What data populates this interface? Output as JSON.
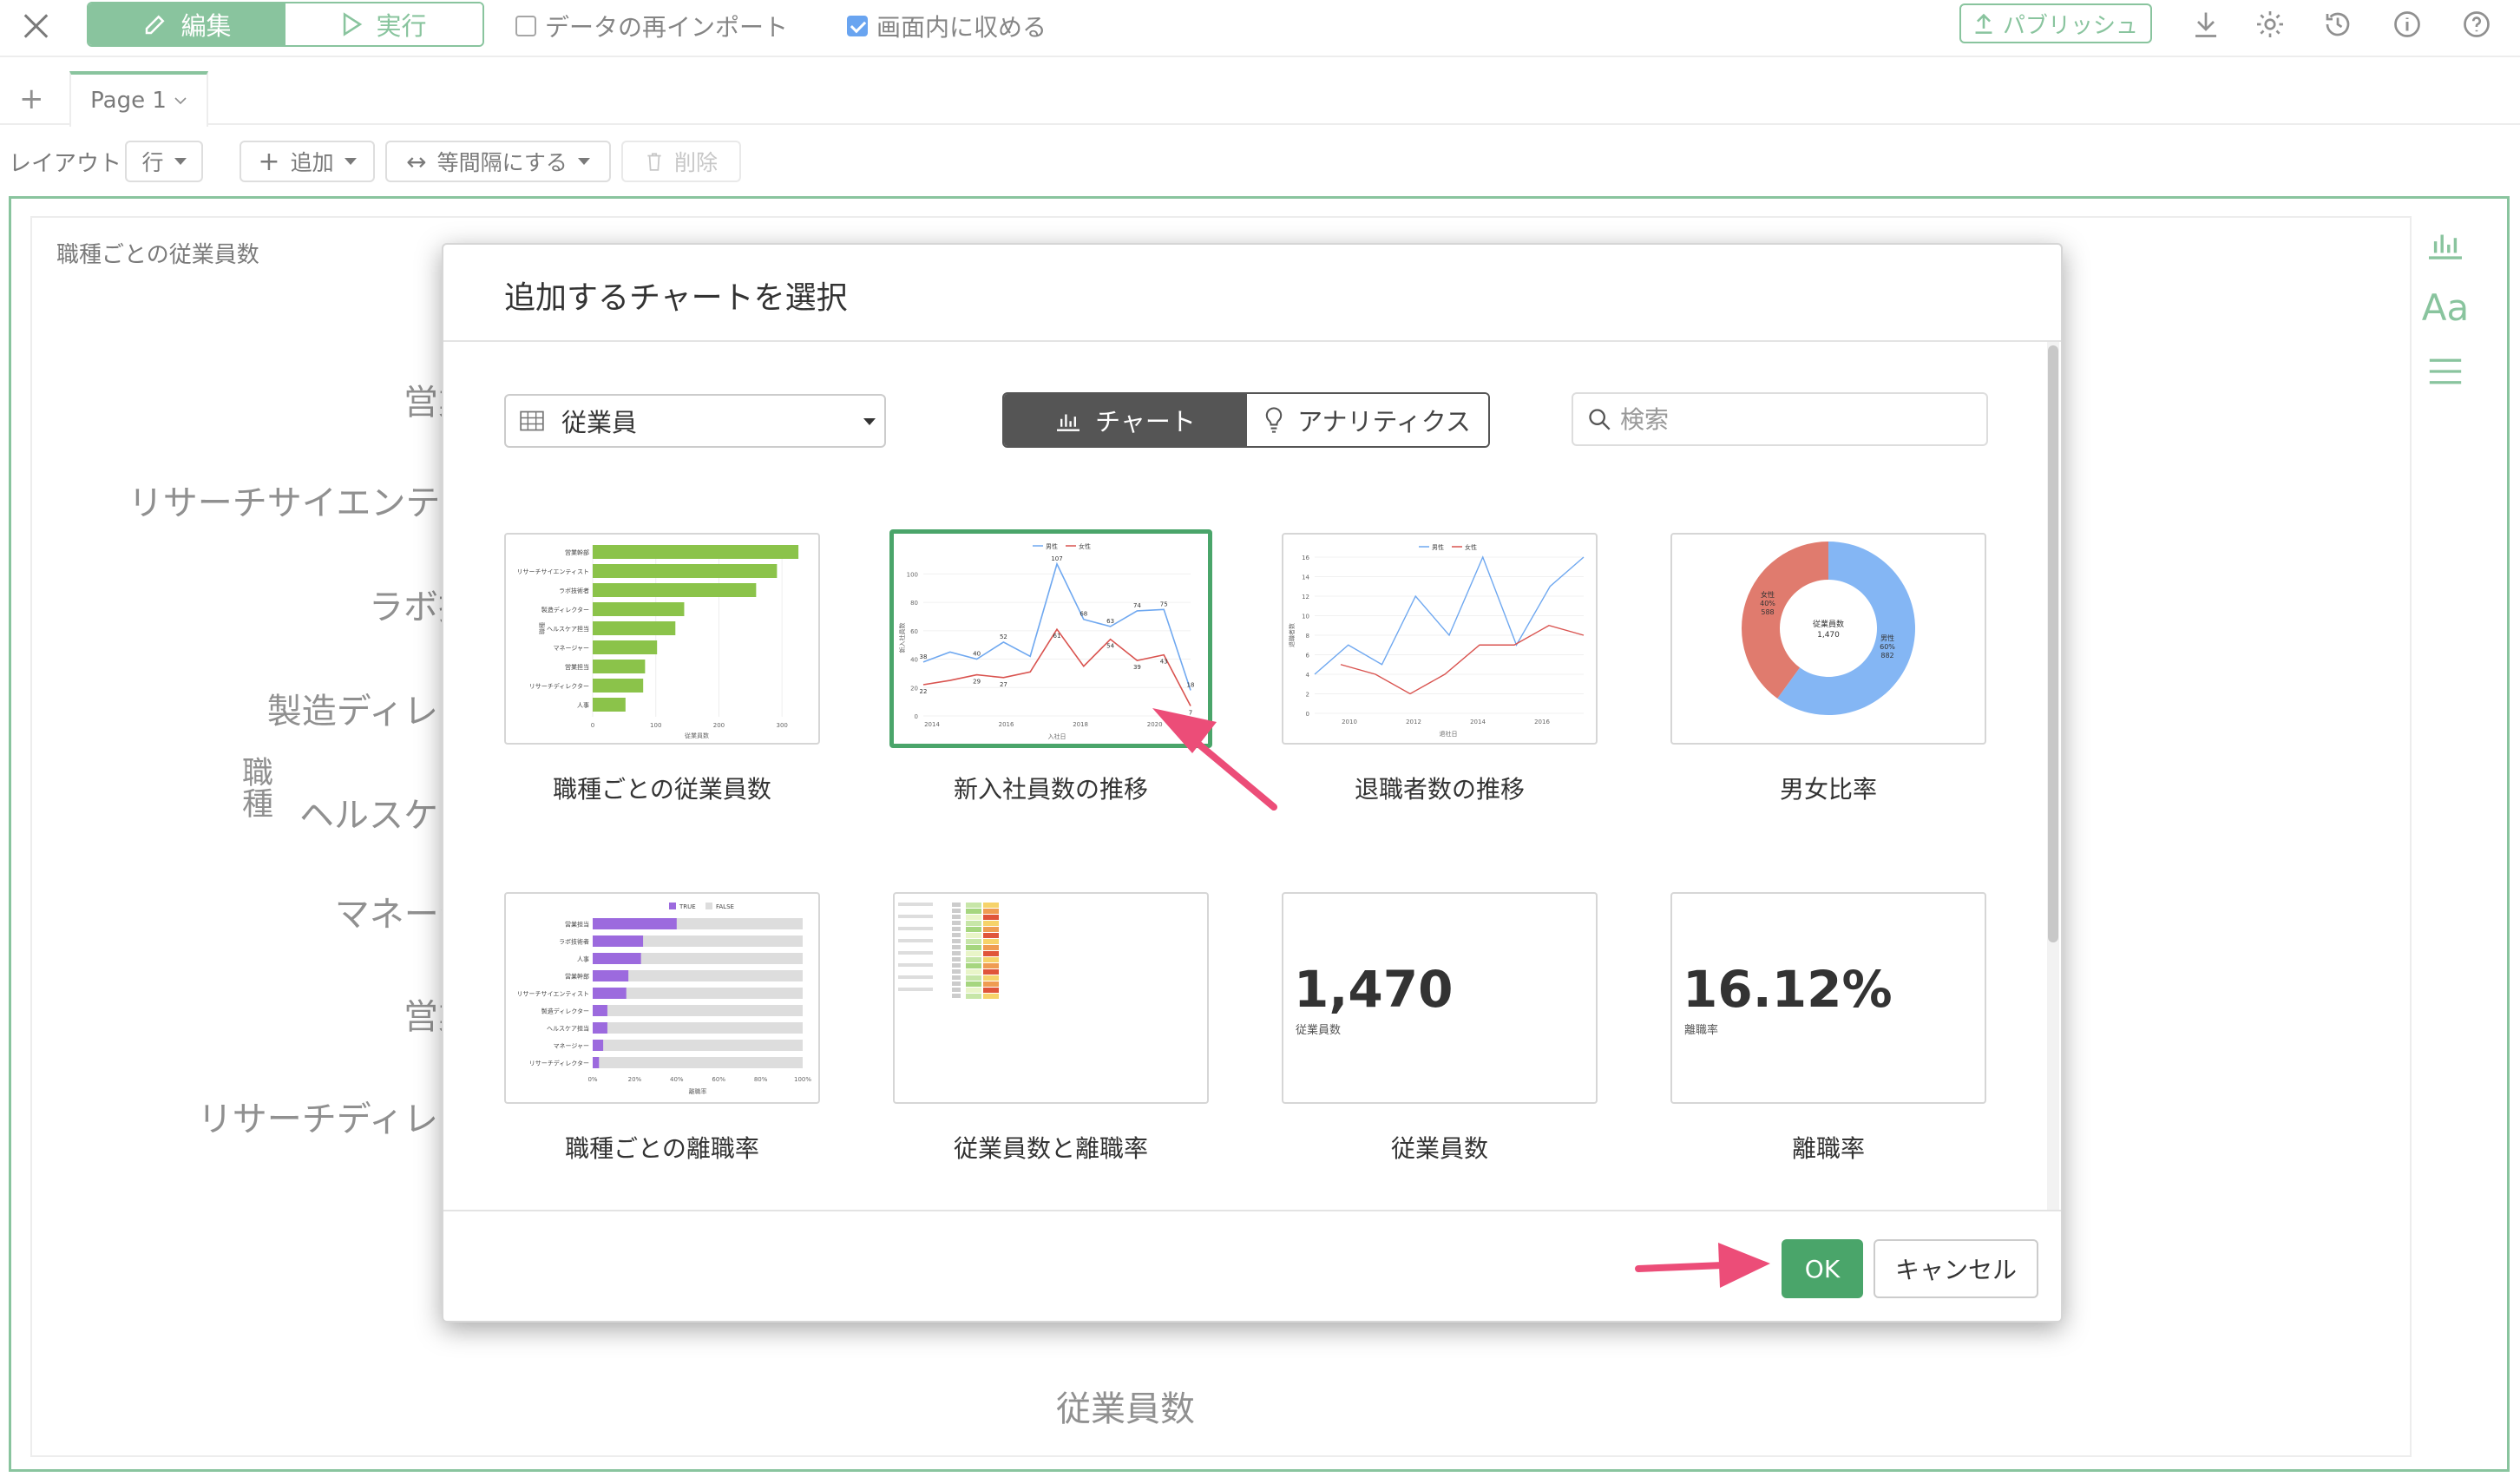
{
  "toolbar": {
    "edit_label": "編集",
    "run_label": "実行",
    "reimport_label": "データの再インポート",
    "reimport_checked": false,
    "fit_label": "画面内に収める",
    "fit_checked": true,
    "publish_label": "パブリッシュ",
    "icons": [
      "download-icon",
      "gear-icon",
      "history-icon",
      "info-icon",
      "help-icon"
    ],
    "accent_color": "#4aa56a"
  },
  "tabs": {
    "add_label": "+",
    "pages": [
      {
        "label": "Page 1"
      }
    ]
  },
  "layout_bar": {
    "layout_label": "レイアウト",
    "layout_value": "行",
    "add_label": "追加",
    "distribute_label": "等間隔にする",
    "delete_label": "削除"
  },
  "canvas": {
    "panel_title": "職種ごとの従業員数",
    "bg_labels": [
      "営業",
      "リサーチサイエンティ",
      "ラボ技",
      "製造ディレク",
      "ヘルスケア",
      "マネージ",
      "営業",
      "リサーチディレク"
    ],
    "bg_ylabel": "職種",
    "bg_xlabel": "従業員数",
    "side_icons": [
      "bar-chart-icon",
      "text-icon",
      "menu-icon"
    ]
  },
  "modal": {
    "title": "追加するチャートを選択",
    "dataset": "従業員",
    "segment_chart": "チャート",
    "segment_analytics": "アナリティクス",
    "search_placeholder": "検索",
    "ok_label": "OK",
    "cancel_label": "キャンセル",
    "cards": [
      {
        "label": "職種ごとの従業員数",
        "selected": false
      },
      {
        "label": "新入社員数の推移",
        "selected": true
      },
      {
        "label": "退職者数の推移",
        "selected": false
      },
      {
        "label": "男女比率",
        "selected": false
      },
      {
        "label": "職種ごとの離職率",
        "selected": false
      },
      {
        "label": "従業員数と離職率",
        "selected": false
      },
      {
        "label": "従業員数",
        "selected": false
      },
      {
        "label": "離職率",
        "selected": false
      }
    ]
  },
  "thumbnails": {
    "bar_headcount": {
      "categories": [
        "営業幹部",
        "リサーチサイエンティスト",
        "ラボ技術者",
        "製造ディレクター",
        "ヘルスケア担当",
        "マネージャー",
        "営業担当",
        "リサーチディレクター",
        "人事"
      ],
      "values": [
        326,
        292,
        259,
        145,
        131,
        102,
        83,
        80,
        52
      ],
      "xlabel": "従業員数",
      "ylabel": "職種",
      "ticks": [
        "0",
        "100",
        "200",
        "300"
      ],
      "color": "#8bc34a"
    },
    "line_hires": {
      "legend": [
        "男性",
        "女性"
      ],
      "x_ticks": [
        "2014",
        "2016",
        "2018",
        "2020"
      ],
      "y_ticks": [
        "0",
        "20",
        "40",
        "60",
        "80",
        "100"
      ],
      "male": [
        38,
        45,
        40,
        52,
        42,
        107,
        68,
        63,
        74,
        75,
        18
      ],
      "female": [
        22,
        25,
        29,
        27,
        31,
        61,
        35,
        54,
        39,
        43,
        7
      ],
      "male_labels": [
        "38",
        "",
        "40",
        "52",
        "",
        "107",
        "68",
        "63",
        "74",
        "75",
        "18"
      ],
      "female_labels": [
        "22",
        "",
        "29",
        "27",
        "",
        "61",
        "",
        "54",
        "39",
        "43",
        "7"
      ],
      "xlabel": "入社日",
      "ylabel": "新入社員数",
      "male_color": "#6fa8f0",
      "female_color": "#d9534f"
    },
    "line_leavers": {
      "legend": [
        "男性",
        "女性"
      ],
      "x_ticks": [
        "2010",
        "2012",
        "2014",
        "2016"
      ],
      "y_ticks": [
        "0",
        "2",
        "4",
        "6",
        "8",
        "10",
        "12",
        "14",
        "16"
      ],
      "male": [
        4,
        7,
        5,
        12,
        8,
        16,
        7,
        13,
        16
      ],
      "female": [
        5,
        4,
        2,
        4,
        7,
        7,
        9,
        8
      ],
      "xlabel": "退社日",
      "ylabel": "退職者数"
    },
    "donut_gender": {
      "center_title": "従業員数",
      "center_value": "1,470",
      "female_label": "女性",
      "female_pct": "40%",
      "female_count": "588",
      "male_label": "男性",
      "male_pct": "60%",
      "male_count": "882",
      "female_fraction": 0.4,
      "female_color": "#e07b6e",
      "male_color": "#84b6f4"
    },
    "bar_attrition": {
      "legend": [
        "TRUE",
        "FALSE"
      ],
      "categories": [
        "営業担当",
        "ラボ技術者",
        "人事",
        "営業幹部",
        "リサーチサイエンティスト",
        "製造ディレクター",
        "ヘルスケア担当",
        "マネージャー",
        "リサーチディレクター"
      ],
      "values": [
        0.4,
        0.24,
        0.23,
        0.17,
        0.16,
        0.07,
        0.07,
        0.05,
        0.03
      ],
      "ticks": [
        "0%",
        "20%",
        "40%",
        "60%",
        "80%",
        "100%"
      ],
      "xlabel": "離職率",
      "true_color": "#9c6ade",
      "false_color": "#dddddd"
    },
    "kpi_headcount": {
      "value": "1,470",
      "label": "従業員数"
    },
    "kpi_rate": {
      "value": "16.12%",
      "label": "離職率"
    }
  },
  "annotations": {
    "arrow_color": "#ec4d78"
  }
}
